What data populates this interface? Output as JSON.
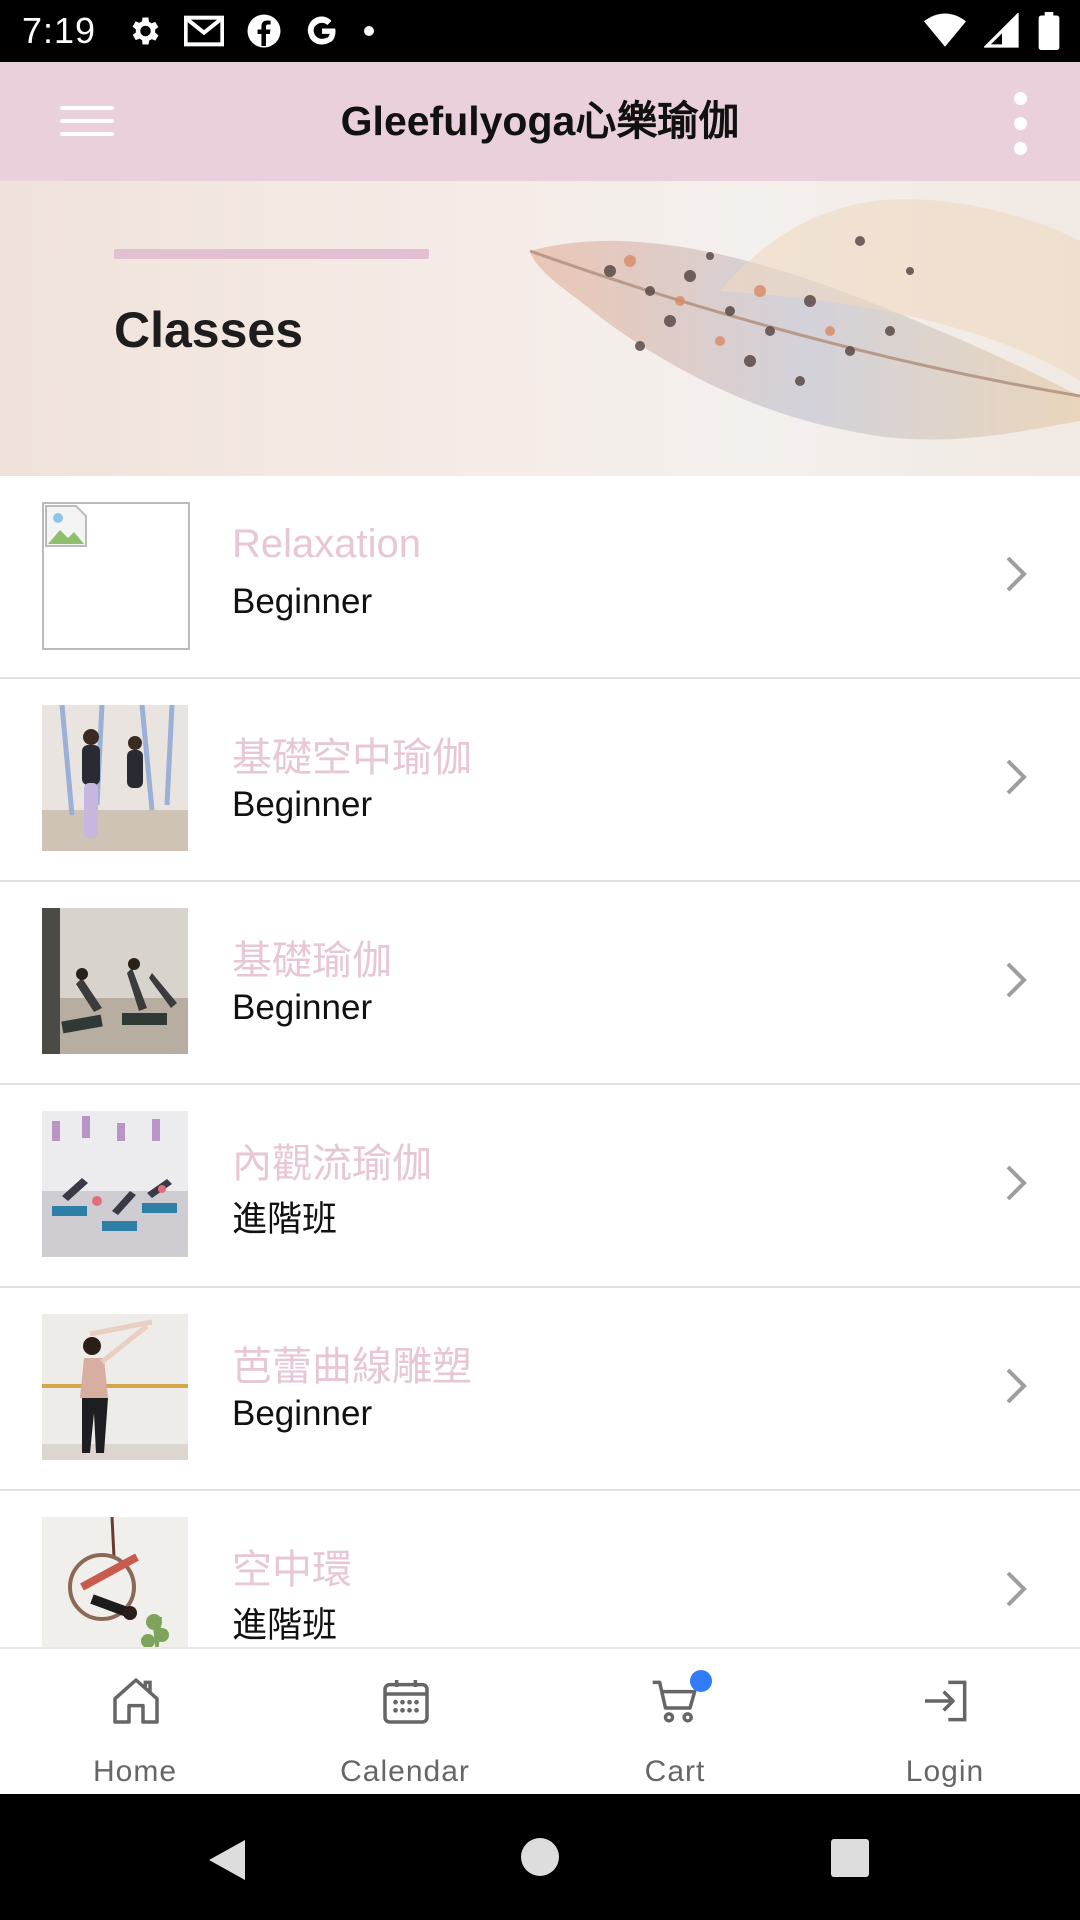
{
  "status_bar": {
    "time": "7:19"
  },
  "app_bar": {
    "title": "Gleefulyoga心樂瑜伽"
  },
  "banner": {
    "title": "Classes"
  },
  "classes": [
    {
      "title": "Relaxation",
      "level": "Beginner"
    },
    {
      "title": "基礎空中瑜伽",
      "level": "Beginner"
    },
    {
      "title": "基礎瑜伽",
      "level": "Beginner"
    },
    {
      "title": "內觀流瑜伽",
      "level": "進階班"
    },
    {
      "title": "芭蕾曲線雕塑",
      "level": "Beginner"
    },
    {
      "title": "空中環",
      "level": "進階班"
    }
  ],
  "bottom_nav": [
    {
      "label": "Home",
      "icon": "home-icon"
    },
    {
      "label": "Calendar",
      "icon": "calendar-icon"
    },
    {
      "label": "Cart",
      "icon": "cart-icon"
    },
    {
      "label": "Login",
      "icon": "login-icon"
    }
  ],
  "colors": {
    "app_bar": "#ead0dc",
    "class_title": "#e7c6d6",
    "accent": "#e2bfd1",
    "cart_badge": "#2f7cf6"
  }
}
